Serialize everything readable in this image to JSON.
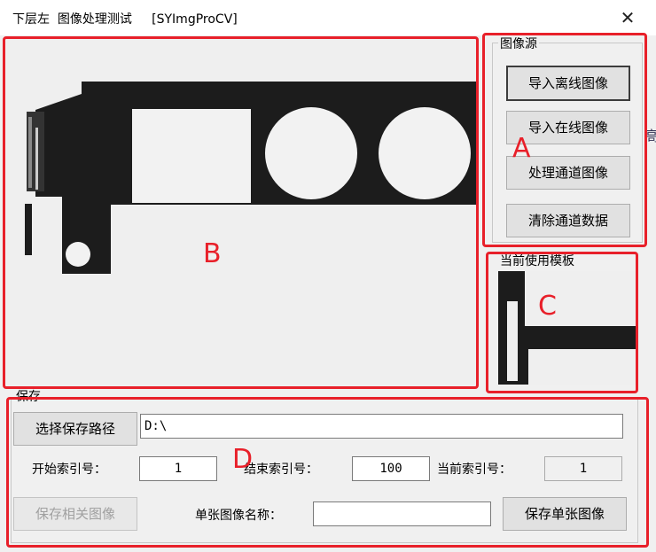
{
  "window": {
    "title": "下层左  图像处理测试     [SYImgProCV]",
    "close_glyph": "✕"
  },
  "image_source": {
    "group_label": "图像源",
    "buttons": [
      "导入离线图像",
      "导入在线图像",
      "处理通道图像",
      "清除通道数据"
    ]
  },
  "template": {
    "group_label": "当前使用模板"
  },
  "save": {
    "group_label": "保存",
    "choose_path_label": "选择保存路径",
    "path_value": "D:\\",
    "start_index_label": "开始索引号：",
    "start_index_value": "1",
    "end_index_label": "结束索引号：",
    "end_index_value": "100",
    "current_index_label": "当前索引号：",
    "current_index_value": "1",
    "save_related_label": "保存相关图像",
    "single_name_label": "单张图像名称：",
    "single_name_value": "",
    "save_single_label": "保存单张图像"
  },
  "annotations": {
    "a": "A",
    "b": "B",
    "c": "C",
    "d": "D"
  },
  "background_fragment": "高"
}
